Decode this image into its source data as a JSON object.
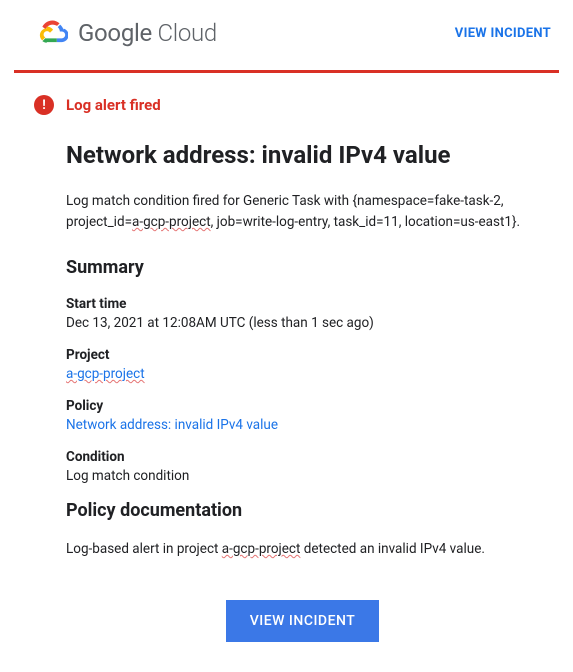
{
  "header": {
    "brand_google": "Google",
    "brand_cloud": " Cloud",
    "view_incident": "VIEW INCIDENT"
  },
  "alert": {
    "label": "Log alert fired"
  },
  "main": {
    "title": "Network address: invalid IPv4 value",
    "lead_prefix": "Log match condition fired for Generic Task with {namespace=fake-task-2, project_id=",
    "lead_proj": "a-gcp-project",
    "lead_suffix": ", job=write-log-entry, task_id=11, location=us-east1}.",
    "summary_heading": "Summary",
    "fields": {
      "start_time_label": "Start time",
      "start_time_value": "Dec 13, 2021 at 12:08AM UTC (less than 1 sec ago)",
      "project_label": "Project",
      "project_value": "a-gcp-project",
      "policy_label": "Policy",
      "policy_value": "Network address: invalid IPv4 value",
      "condition_label": "Condition",
      "condition_value": "Log match condition"
    },
    "doc_heading": "Policy documentation",
    "doc_prefix": "Log-based alert in project ",
    "doc_proj": "a-gcp-project",
    "doc_suffix": " detected an invalid IPv4 value.",
    "button": "VIEW INCIDENT"
  }
}
